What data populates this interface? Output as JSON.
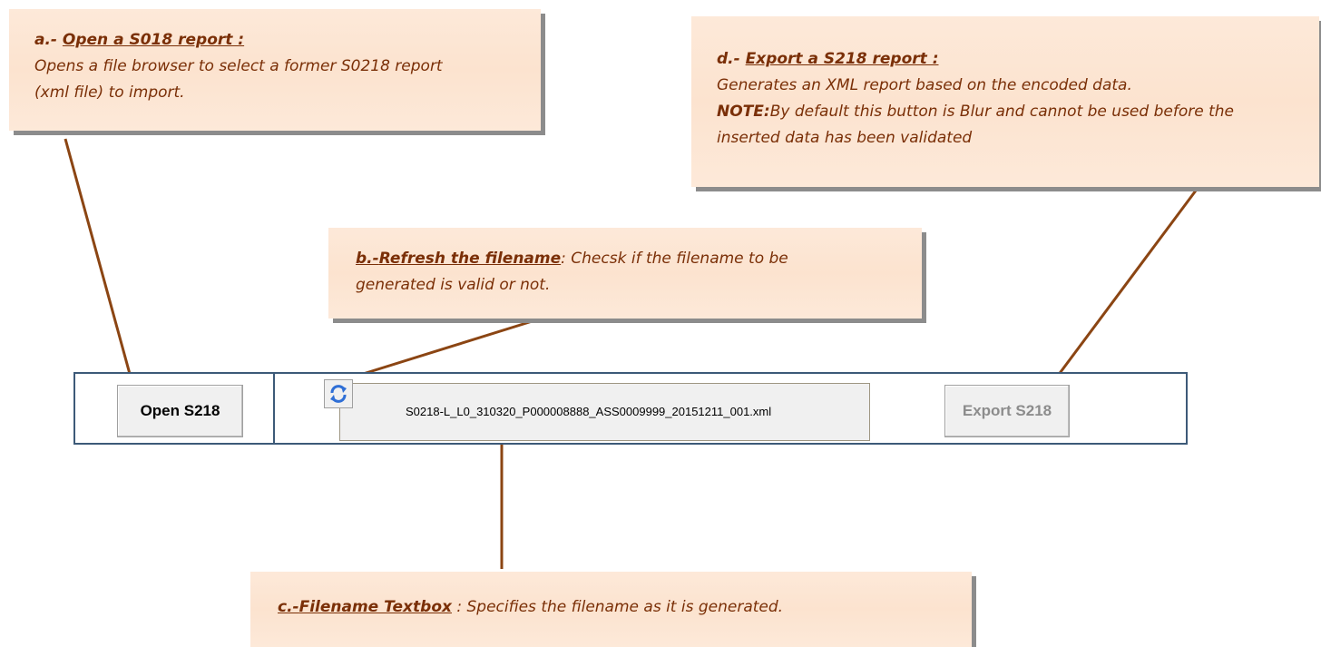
{
  "callouts": {
    "a": {
      "prefix": "a.- ",
      "title": "Open a S018 report :",
      "lines": [
        "Opens a file browser to select a former S0218 report",
        "(xml file) to import."
      ]
    },
    "b": {
      "prefix": "b.-",
      "title": "Refresh the filename",
      "line1_rest": ": Checsk if the filename to be",
      "line2": "generated is valid or not."
    },
    "c": {
      "prefix": "c.-",
      "title": "Filename Textbox",
      "rest": " : Specifies the filename as it is generated."
    },
    "d": {
      "prefix": "d.- ",
      "title": "Export a S218 report :",
      "line1": "Generates an XML report based on the encoded data.",
      "note_label": "NOTE:",
      "note_text": "By default this button is Blur and cannot be used before the",
      "line3": "inserted data has been validated"
    }
  },
  "toolbar": {
    "open_label": "Open S218",
    "filename": "S0218-L_L0_310320_P000008888_ASS0009999_20151211_001.xml",
    "export_label": "Export S218",
    "export_enabled": false,
    "refresh_icon": "refresh-icon"
  },
  "colors": {
    "callout_text": "#7a2f07",
    "callout_bg": "#fde9d9",
    "leader_line": "#8b4513",
    "toolbar_border": "#3d5a78"
  }
}
